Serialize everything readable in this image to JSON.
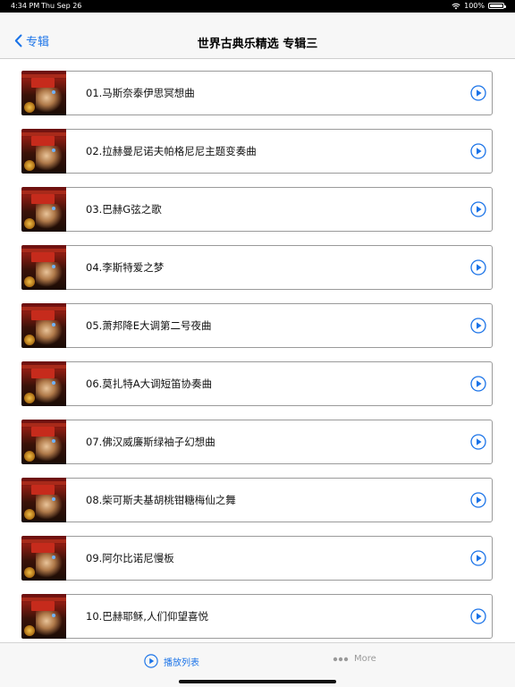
{
  "status_bar": {
    "time": "4:34 PM",
    "date": "Thu Sep 26",
    "battery": "100%"
  },
  "nav": {
    "back_label": "专辑",
    "title": "世界古典乐精选 专辑三"
  },
  "tracks": [
    {
      "title": "01.马斯奈泰伊思冥想曲"
    },
    {
      "title": "02.拉赫曼尼诺夫帕格尼尼主题变奏曲"
    },
    {
      "title": "03.巴赫G弦之歌"
    },
    {
      "title": "04.李斯特爱之梦"
    },
    {
      "title": "05.萧邦降E大调第二号夜曲"
    },
    {
      "title": "06.莫扎特A大调短笛协奏曲"
    },
    {
      "title": "07.佛汉威廉斯绿袖子幻想曲"
    },
    {
      "title": "08.柴可斯夫基胡桃钳糖梅仙之舞"
    },
    {
      "title": "09.阿尔比诺尼慢板"
    },
    {
      "title": "10.巴赫耶稣,人们仰望喜悦"
    }
  ],
  "tab_bar": {
    "playlist_label": "播放列表",
    "more_label": "More"
  },
  "colors": {
    "accent": "#1a73e8",
    "inactive": "#9a9a9a"
  },
  "icons": {
    "back": "chevron-left-icon",
    "play": "play-circle-icon",
    "playlist": "play-circle-icon",
    "more": "ellipsis-icon"
  }
}
